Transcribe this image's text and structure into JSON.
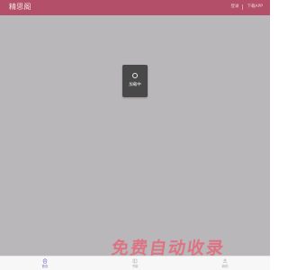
{
  "header": {
    "brand": "精思阁",
    "links": [
      "登录",
      "下载APP"
    ]
  },
  "loading": {
    "text": "加载中"
  },
  "bottom_nav": {
    "items": [
      {
        "label": "首页",
        "icon": "home-icon",
        "active": true
      },
      {
        "label": "书架",
        "icon": "bookshelf-icon",
        "active": false
      },
      {
        "label": "我的",
        "icon": "user-icon",
        "active": false
      }
    ]
  },
  "watermark": {
    "text": "免费自动收录"
  },
  "colors": {
    "header_bg": "#b34f68",
    "overlay": "#969296",
    "active_tab": "#7a6cc1",
    "watermark": "#ec5468"
  }
}
